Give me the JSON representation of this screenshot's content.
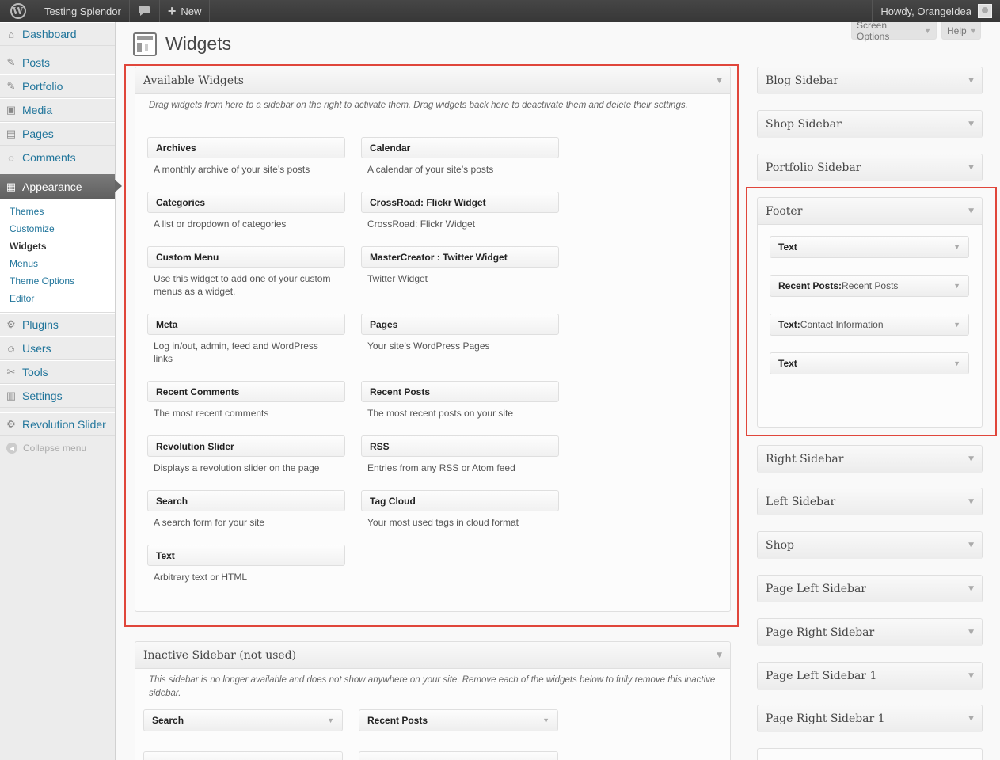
{
  "adminbar": {
    "site_name": "Testing Splendor",
    "new_label": "New",
    "howdy": "Howdy, OrangeIdea"
  },
  "menu": {
    "items": [
      {
        "label": "Dashboard",
        "icon": "dashboard-icon"
      },
      {
        "label": "Posts",
        "icon": "pin-icon"
      },
      {
        "label": "Portfolio",
        "icon": "pin-icon"
      },
      {
        "label": "Media",
        "icon": "media-icon"
      },
      {
        "label": "Pages",
        "icon": "pages-icon"
      },
      {
        "label": "Comments",
        "icon": "comment-icon"
      },
      {
        "label": "Appearance",
        "icon": "appearance-icon"
      },
      {
        "label": "Plugins",
        "icon": "plugin-icon"
      },
      {
        "label": "Users",
        "icon": "users-icon"
      },
      {
        "label": "Tools",
        "icon": "tools-icon"
      },
      {
        "label": "Settings",
        "icon": "settings-icon"
      },
      {
        "label": "Revolution Slider",
        "icon": "gear-icon"
      }
    ],
    "appearance_sub": [
      "Themes",
      "Customize",
      "Widgets",
      "Menus",
      "Theme Options",
      "Editor"
    ],
    "collapse": "Collapse menu"
  },
  "screen_options": "Screen Options",
  "help": "Help",
  "page_title": "Widgets",
  "available": {
    "title": "Available Widgets",
    "description": "Drag widgets from here to a sidebar on the right to activate them. Drag widgets back here to deactivate them and delete their settings.",
    "widgets": [
      {
        "title": "Archives",
        "desc": "A monthly archive of your site’s posts"
      },
      {
        "title": "Calendar",
        "desc": "A calendar of your site’s posts"
      },
      {
        "title": "Categories",
        "desc": "A list or dropdown of categories"
      },
      {
        "title": "CrossRoad: Flickr Widget",
        "desc": "CrossRoad: Flickr Widget"
      },
      {
        "title": "Custom Menu",
        "desc": "Use this widget to add one of your custom menus as a widget."
      },
      {
        "title": "MasterCreator : Twitter Widget",
        "desc": "Twitter Widget"
      },
      {
        "title": "Meta",
        "desc": "Log in/out, admin, feed and WordPress links"
      },
      {
        "title": "Pages",
        "desc": "Your site’s WordPress Pages"
      },
      {
        "title": "Recent Comments",
        "desc": "The most recent comments"
      },
      {
        "title": "Recent Posts",
        "desc": "The most recent posts on your site"
      },
      {
        "title": "Revolution Slider",
        "desc": "Displays a revolution slider on the page"
      },
      {
        "title": "RSS",
        "desc": "Entries from any RSS or Atom feed"
      },
      {
        "title": "Search",
        "desc": "A search form for your site"
      },
      {
        "title": "Tag Cloud",
        "desc": "Your most used tags in cloud format"
      },
      {
        "title": "Text",
        "desc": "Arbitrary text or HTML"
      }
    ]
  },
  "inactive": {
    "title": "Inactive Sidebar (not used)",
    "description": "This sidebar is no longer available and does not show anywhere on your site. Remove each of the widgets below to fully remove this inactive sidebar.",
    "widgets": [
      "Search",
      "Recent Posts"
    ]
  },
  "sidebars": [
    "Blog Sidebar",
    "Shop Sidebar",
    "Portfolio Sidebar",
    "Footer",
    "Right Sidebar",
    "Left Sidebar",
    "Shop",
    "Page Left Sidebar",
    "Page Right Sidebar",
    "Page Left Sidebar 1",
    "Page Right Sidebar 1"
  ],
  "footer_widgets": [
    {
      "name": "Text",
      "sub": ""
    },
    {
      "name": "Recent Posts:",
      "sub": " Recent Posts"
    },
    {
      "name": "Text:",
      "sub": " Contact Information"
    },
    {
      "name": "Text",
      "sub": ""
    }
  ],
  "colors": {
    "highlight": "#e0463b",
    "link": "#21759b"
  }
}
